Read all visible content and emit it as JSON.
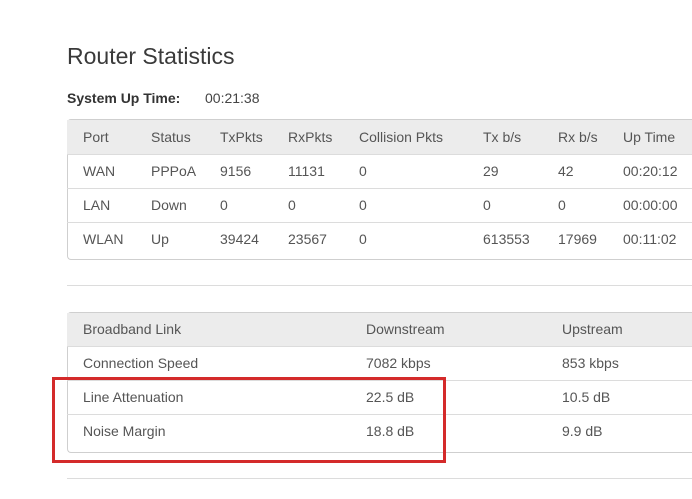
{
  "page": {
    "title": "Router Statistics",
    "uptime_label": "System Up Time:",
    "uptime_value": "00:21:38"
  },
  "port_table": {
    "headers": [
      "Port",
      "Status",
      "TxPkts",
      "RxPkts",
      "Collision Pkts",
      "Tx b/s",
      "Rx b/s",
      "Up Time"
    ],
    "rows": [
      [
        "WAN",
        "PPPoA",
        "9156",
        "11131",
        "0",
        "29",
        "42",
        "00:20:12"
      ],
      [
        "LAN",
        "Down",
        "0",
        "0",
        "0",
        "0",
        "0",
        "00:00:00"
      ],
      [
        "WLAN",
        "Up",
        "39424",
        "23567",
        "0",
        "613553",
        "17969",
        "00:11:02"
      ]
    ]
  },
  "broadband_table": {
    "headers": [
      "Broadband Link",
      "Downstream",
      "Upstream"
    ],
    "rows": [
      [
        "Connection Speed",
        "7082 kbps",
        "853 kbps"
      ],
      [
        "Line Attenuation",
        "22.5 dB",
        "10.5 dB"
      ],
      [
        "Noise Margin",
        "18.8 dB",
        "9.9 dB"
      ]
    ]
  },
  "annotation": {
    "highlight_color": "#d42a2a"
  }
}
